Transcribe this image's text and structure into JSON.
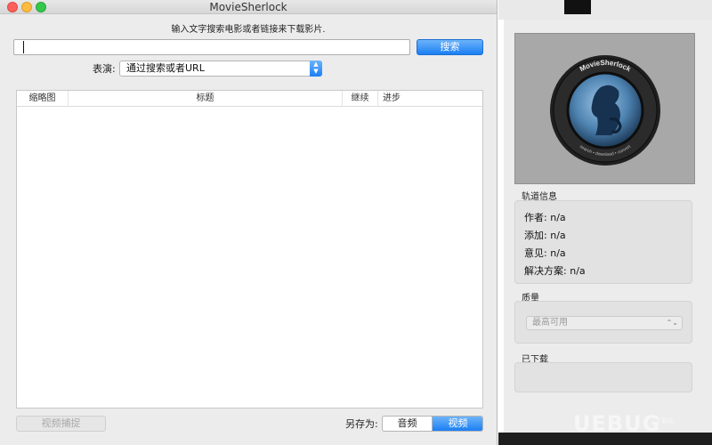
{
  "window": {
    "title": "MovieSherlock",
    "hint": "输入文字搜索电影或者链接来下载影片.",
    "search": {
      "value": "",
      "placeholder": ""
    },
    "search_button": "搜索",
    "performance_label": "表演:",
    "source_select": "通过搜索或者URL",
    "table": {
      "columns": [
        "缩略图",
        "标题",
        "继续",
        "进步"
      ],
      "rows": []
    },
    "capture_button": "视频捕捉",
    "save_as_label": "另存为:",
    "save_as_options": [
      "音频",
      "视频"
    ],
    "save_as_selected": "视频"
  },
  "panel": {
    "logo": {
      "top_text": "MovieSherlock",
      "ring_text": "search • download • convert"
    },
    "track_info_label": "轨道信息",
    "track_info": [
      {
        "key": "作者:",
        "value": "n/a"
      },
      {
        "key": "添加:",
        "value": "n/a"
      },
      {
        "key": "意见:",
        "value": "n/a"
      },
      {
        "key": "解决方案:",
        "value": "n/a"
      }
    ],
    "quality_label": "质量",
    "quality_select": "最高可用",
    "downloaded_label": "已下载"
  },
  "watermark": {
    "text": "UEBUG",
    "sub": "下载站"
  },
  "colors": {
    "accent": "#1b7ff3",
    "window_bg": "#ececec",
    "artwork_bg": "#a8a8a8"
  }
}
